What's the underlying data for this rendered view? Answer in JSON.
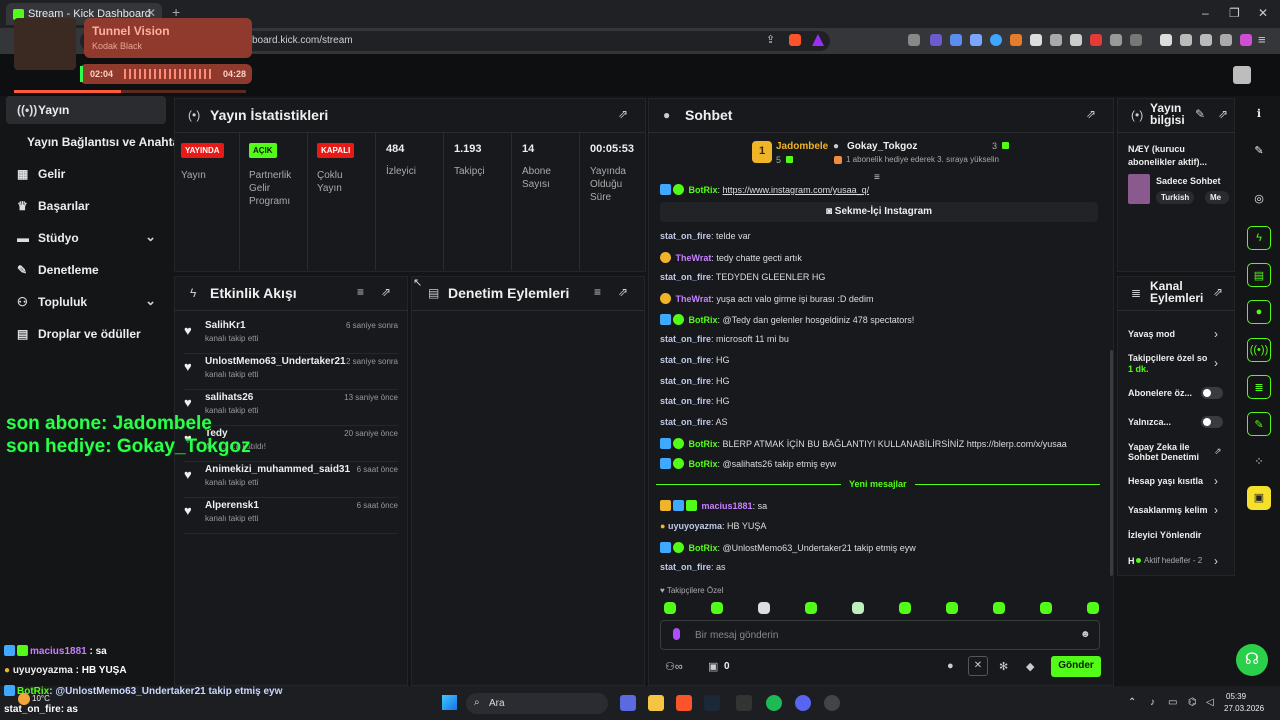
{
  "browser": {
    "tab_title": "Stream - Kick Dashboard",
    "new_tab_symbol": "+",
    "url": "board.kick.com/stream"
  },
  "music": {
    "title": "Tunnel Vision",
    "artist": "Kodak Black",
    "elapsed": "02:04",
    "duration": "04:28",
    "progress": 0.46
  },
  "sidebar": {
    "items": [
      {
        "label": "Yayın",
        "icon": "broadcast-icon"
      },
      {
        "label": "Yayın Bağlantısı ve Anahtarı",
        "icon": ""
      },
      {
        "label": "Gelir",
        "icon": "revenue-icon"
      },
      {
        "label": "Başarılar",
        "icon": "trophy-icon"
      },
      {
        "label": "Stüdyo",
        "icon": "studio-icon"
      },
      {
        "label": "Denetleme",
        "icon": "wrench-icon"
      },
      {
        "label": "Topluluk",
        "icon": "community-icon"
      },
      {
        "label": "Droplar ve ödüller",
        "icon": "gift-icon"
      }
    ]
  },
  "stats": {
    "title": "Yayın İstatistikleri",
    "columns": [
      {
        "badge": "YAYINDA",
        "badge_color": "#e91916",
        "label": "Yayın"
      },
      {
        "badge": "AÇIK",
        "badge_color": "#53fc18",
        "label": "Partnerlik Gelir Programı"
      },
      {
        "badge": "KAPALI",
        "badge_color": "#e91916",
        "label": "Çoklu Yayın"
      },
      {
        "value": "484",
        "label": "İzleyici"
      },
      {
        "value": "1.193",
        "label": "Takipçi"
      },
      {
        "value": "14",
        "label": "Abone Sayısı"
      },
      {
        "value": "00:05:53",
        "label": "Yayında Olduğu Süre"
      }
    ]
  },
  "activity": {
    "title": "Etkinlik Akışı",
    "items": [
      {
        "name": "SalihKr1",
        "sub": "kanalı takip etti",
        "time": "6 saniye sonra"
      },
      {
        "name": "UnlostMemo63_Undertaker21",
        "sub": "kanalı takip etti",
        "time": "2 saniye sonra"
      },
      {
        "name": "salihats26",
        "sub": "kanalı takip etti",
        "time": "13 saniye önce"
      },
      {
        "name": "Tedy",
        "sub": "4... ...nıza katıldı!",
        "time": "20 saniye önce"
      },
      {
        "name": "Animekizi_muhammed_said31",
        "sub": "kanalı takip etti",
        "time": "6 saat önce"
      },
      {
        "name": "Alperensk1",
        "sub": "kanalı takip etti",
        "time": "6 saat önce"
      }
    ]
  },
  "moderation": {
    "title": "Denetim Eylemleri"
  },
  "chat": {
    "title": "Sohbet",
    "pinned": {
      "rank": "1",
      "user1": "Jadombele",
      "user1_count": "5",
      "user2": "Gokay_Tokgoz",
      "user2_count": "3",
      "note": "1 abonelik hediye ederek 3. sıraya yükselin"
    },
    "top_link_user": "BotRix",
    "top_link": "https://www.instagram.com/yusaa_q/",
    "instagram_button": "Sekme-İçi Instagram",
    "messages": [
      {
        "user": "stat_on_fire",
        "text": "telde var",
        "style": "u1",
        "icon": ""
      },
      {
        "user": "TheWrat",
        "text": "tedy chatte gecti artık",
        "style": "u2",
        "icon": "emoji"
      },
      {
        "user": "stat_on_fire",
        "text": "TEDYDEN GLEENLER HG",
        "style": "u1",
        "icon": ""
      },
      {
        "user": "TheWrat",
        "text": "yuşa actı valo girme işi burası :D dedim",
        "style": "u2",
        "icon": "emoji"
      },
      {
        "user": "BotRix",
        "text": "@Tedy dan gelenler hosgeldiniz 478 spectators!",
        "style": "u3",
        "icon": "bot"
      },
      {
        "user": "stat_on_fire",
        "text": "microsoft 11 mi bu",
        "style": "u1",
        "icon": ""
      },
      {
        "user": "stat_on_fire",
        "text": "HG",
        "style": "u1",
        "icon": ""
      },
      {
        "user": "stat_on_fire",
        "text": "HG",
        "style": "u1",
        "icon": ""
      },
      {
        "user": "stat_on_fire",
        "text": "HG",
        "style": "u1",
        "icon": ""
      },
      {
        "user": "stat_on_fire",
        "text": "AS",
        "style": "u1",
        "icon": ""
      },
      {
        "user": "BotRix",
        "text": "BLERP ATMAK İÇİN BU BAĞLANTIYI KULLANABİLİRSİNİZ https://blerp.com/x/yusaa",
        "style": "u3",
        "icon": "bot"
      },
      {
        "user": "BotRix",
        "text": "@salihats26 takip etmiş eyw",
        "style": "u3",
        "icon": "bot"
      }
    ],
    "new_messages_label": "Yeni mesajlar",
    "new_messages": [
      {
        "user": "macius1881",
        "text": "sa",
        "style": "u2",
        "icon": "badges"
      },
      {
        "user": "uyuyoyazma",
        "text": "HB YUŞA",
        "style": "u1",
        "icon": "dot"
      },
      {
        "user": "BotRix",
        "text": "@UnlostMemo63_Undertaker21 takip etmiş eyw",
        "style": "u3",
        "icon": "bot"
      },
      {
        "user": "stat_on_fire",
        "text": "as",
        "style": "u1",
        "icon": ""
      }
    ],
    "followers_only_label": "Takipçilere Özel",
    "input_placeholder": "Bir mesaj gönderin",
    "points": "0",
    "send_label": "Gönder"
  },
  "stream_info": {
    "title": "Yayın bilgisi",
    "description": "NÆY (kurucu abonelikler aktif)...",
    "category": "Sadece Sohbet",
    "tags": [
      "Turkish",
      "Me"
    ]
  },
  "channel_actions": {
    "title": "Kanal Eylemleri",
    "items": [
      {
        "label": "Yavaş mod",
        "control": "chevron"
      },
      {
        "label": "Takipçilere özel so",
        "extra": "1 dk.",
        "control": "chevron"
      },
      {
        "label": "Abonelere öz...",
        "control": "toggle"
      },
      {
        "label": "Yalnızca...",
        "control": "toggle"
      },
      {
        "label": "Yapay Zeka ile Sohbet Denetimi",
        "control": "external"
      },
      {
        "label": "Hesap yaşı kısıtla",
        "control": "chevron"
      },
      {
        "label": "Yasaklanmış kelim",
        "control": "chevron"
      },
      {
        "label": "İzleyici Yönlendir",
        "control": ""
      },
      {
        "label": "H",
        "extra": "Aktif hedefler - 2",
        "control": "chevron"
      }
    ]
  },
  "overlay": {
    "last_sub": "son abone: Jadombele",
    "last_gift": "son hediye: Gokay_Tokgoz",
    "chat": [
      {
        "user": "macius1881",
        "text": ": sa"
      },
      {
        "user": "uyuyoyazma",
        "text": ": HB YUŞA"
      },
      {
        "user": "BotRix",
        "text": ": @UnlostMemo63_Undertaker21 takip etmiş eyw"
      },
      {
        "user": "stat_on_fire",
        "text": ": as"
      }
    ]
  },
  "taskbar": {
    "search": "Ara",
    "weather": "10°C",
    "time": "05:39",
    "date": "27.03.2026"
  },
  "colors": {
    "accent": "#53fc18",
    "live": "#e91916"
  }
}
